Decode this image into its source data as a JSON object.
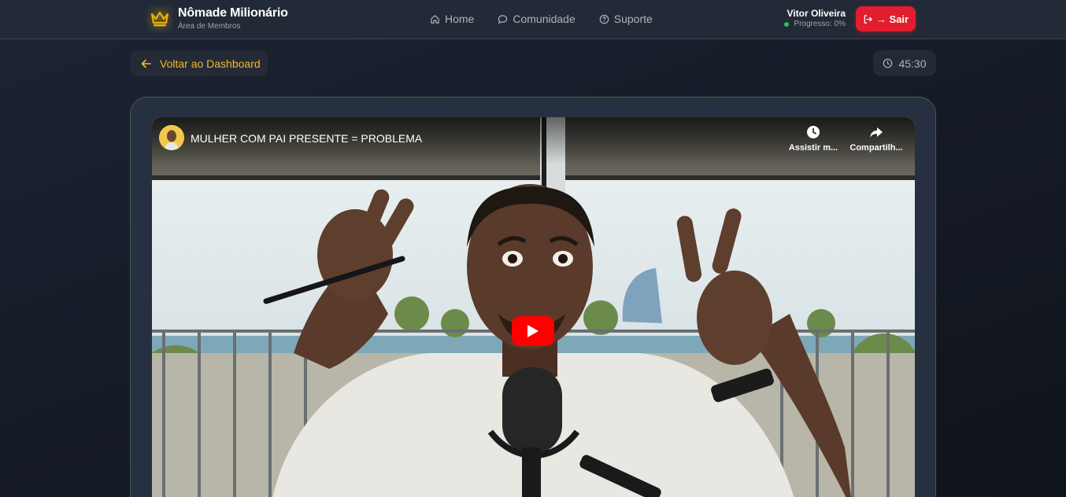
{
  "header": {
    "brand_title": "Nômade Milionário",
    "brand_subtitle": "Área de Membros",
    "nav": [
      {
        "label": "Home",
        "icon": "home-icon"
      },
      {
        "label": "Comunidade",
        "icon": "chat-bubble-icon"
      },
      {
        "label": "Suporte",
        "icon": "help-circle-icon"
      }
    ],
    "user_name": "Vitor Oliveira",
    "user_progress": "Progresso: 0%",
    "logout_label": "→ Sair"
  },
  "toolbar": {
    "back_label": "Voltar ao Dashboard",
    "duration": "45:30"
  },
  "video": {
    "title": "MULHER COM PAI PRESENTE = PROBLEMA",
    "watch_later_label": "Assistir m...",
    "share_label": "Compartilh..."
  },
  "colors": {
    "accent": "#f5b921",
    "danger": "#e11d2e",
    "status_online": "#22c55e",
    "youtube_red": "#ff0000"
  }
}
